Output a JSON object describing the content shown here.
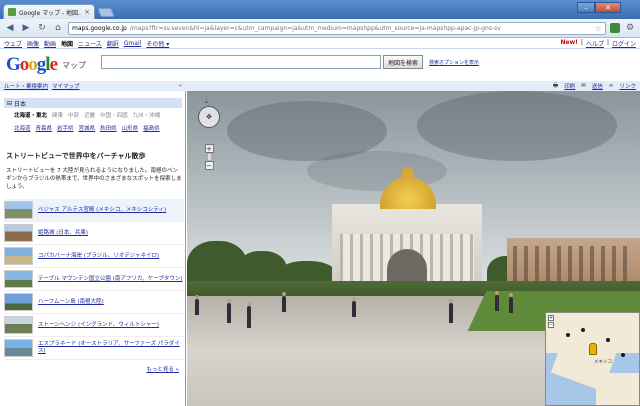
{
  "browser": {
    "tab_title": "Google マップ - 地図...",
    "tab_close": "×",
    "url_host": "maps.google.co.jp",
    "url_path": "/maps?ftr=sv.seven&hl=ja&layer=c&utm_campaign=ja&utm_medium=mapshpp&utm_source=ja-mapshpp-apac-jp-gns-sv",
    "back_icon": "◀",
    "forward_icon": "▶",
    "reload_icon": "↻",
    "home_icon": "⌂",
    "star_icon": "☆",
    "minimize": "–",
    "maximize": "□",
    "close": "✕"
  },
  "gbar": {
    "items": [
      "ウェブ",
      "画像",
      "動画",
      "地図",
      "ニュース",
      "翻訳",
      "Gmail",
      "その他 ▾"
    ],
    "active_index": 3,
    "new_label": "New!",
    "history": "ウェブ履歴",
    "help": "ヘルプ",
    "login": "ログイン"
  },
  "header": {
    "logo_letters": [
      "G",
      "o",
      "o",
      "g",
      "l",
      "e"
    ],
    "product": "マップ",
    "search_value": "",
    "search_button": "地図を検索",
    "search_options": "検索オプションを表示"
  },
  "linkbar": {
    "route": "ルート・乗換案内",
    "mymaps": "マイマップ",
    "collapse": "«"
  },
  "maptools": {
    "print": "印刷",
    "send": "送信",
    "link": "リンク"
  },
  "sidebar": {
    "region_title": "日本",
    "region_toggle": "⊟",
    "regions": [
      "北海道・東北",
      "関東",
      "中部",
      "近畿",
      "中国・四国",
      "九州・沖縄"
    ],
    "selected_region": 0,
    "prefectures": [
      "北海道",
      "青森県",
      "岩手県",
      "宮城県",
      "秋田県",
      "山形県",
      "福島県"
    ],
    "sv_title": "ストリートビューで世界中をバーチャル散歩",
    "sv_desc": "ストリートビューを 7 大陸が見られるようになりました。南極のペンギンからブラジルの熱帯まで、世界中のさまざまなスポットを探索しましょう。",
    "places": [
      "ベジャス アルテス宮殿 (メキシコ、メキシコシティ)",
      "姫路城 (日本、兵庫)",
      "コパカバーナ海岸 (ブラジル、リオデジャネイロ)",
      "テーブル マウンテン国立公園 (南アフリカ、ケープタウン)",
      "ハーフムーン島 (南極大陸)",
      "ストーンヘンジ (イングランド、ウィルトシャー)",
      "エスプラネード (オーストラリア、サーファーズ パラダイス)"
    ],
    "more": "もっと見る »"
  },
  "streetview": {
    "compass": "⊥",
    "pan_icon": "✥",
    "zoom_in": "+",
    "zoom_out": "−",
    "minimap": {
      "labels": [
        "メキシコ"
      ],
      "zoom_in": "+",
      "zoom_out": "−"
    }
  }
}
